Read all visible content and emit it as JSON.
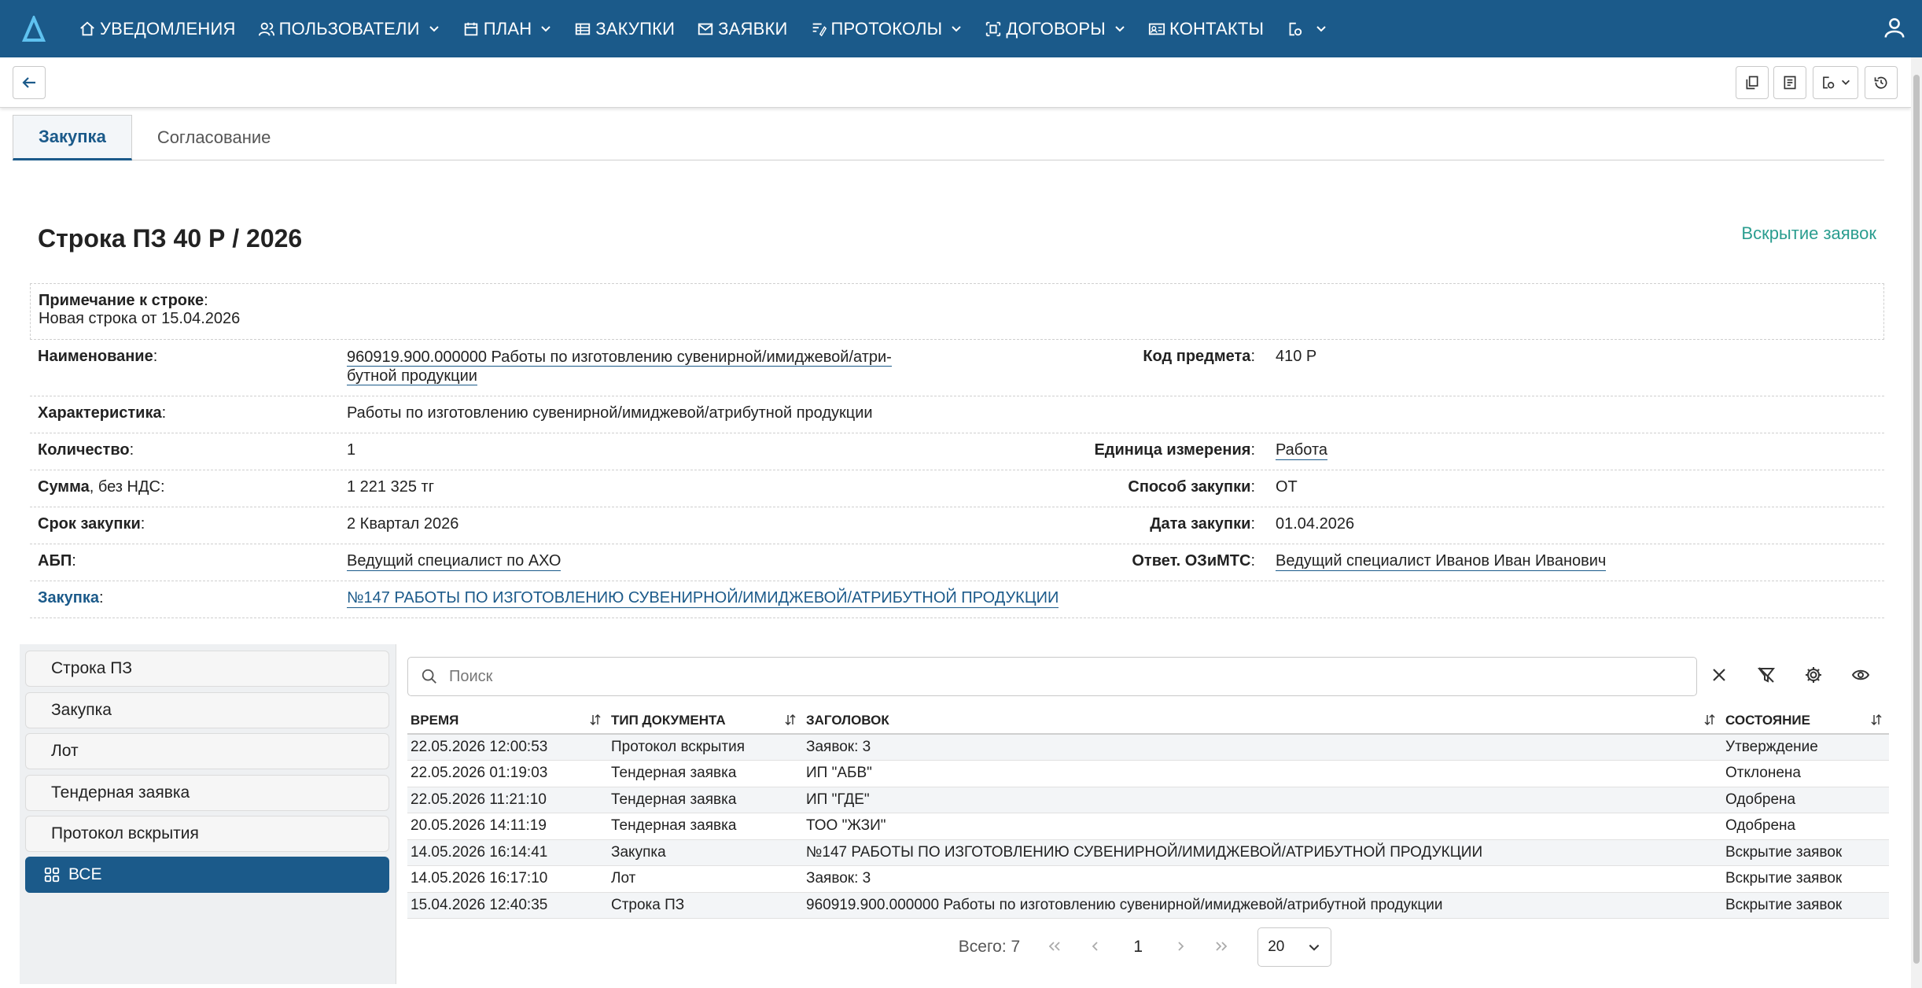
{
  "nav": {
    "items": [
      {
        "label": "УВЕДОМЛЕНИЯ",
        "icon": "home-icon",
        "chevron": false
      },
      {
        "label": "ПОЛЬЗОВАТЕЛИ",
        "icon": "users-icon",
        "chevron": true
      },
      {
        "label": "ПЛАН",
        "icon": "calendar-icon",
        "chevron": true
      },
      {
        "label": "ЗАКУПКИ",
        "icon": "table-icon",
        "chevron": false
      },
      {
        "label": "ЗАЯВКИ",
        "icon": "mail-icon",
        "chevron": false
      },
      {
        "label": "ПРОТОКОЛЫ",
        "icon": "edit-doc-icon",
        "chevron": true
      },
      {
        "label": "ДОГОВОРЫ",
        "icon": "contract-icon",
        "chevron": true
      },
      {
        "label": "КОНТАКТЫ",
        "icon": "contact-card-icon",
        "chevron": false
      }
    ]
  },
  "tabs": [
    {
      "label": "Закупка",
      "active": true
    },
    {
      "label": "Согласование",
      "active": false
    }
  ],
  "page": {
    "title": "Строка ПЗ 40 Р / 2026",
    "status_link": "Вскрытие заявок"
  },
  "details": {
    "note_label": "Примечание к строке",
    "note_value": "Новая строка от 15.04.2026",
    "name_label": "Наименование",
    "name_value_1": "960919.900.000000 Работы по изготовлению сувенирной/имиджевой/атри-",
    "name_value_2": "бутной продукции",
    "code_label": "Код предмета",
    "code_value": "410 Р",
    "char_label": "Характеристика",
    "char_value": "Работы по изготовлению сувенирной/имиджевой/атрибутной продукции",
    "qty_label": "Количество",
    "qty_value": "1",
    "unit_label": "Единица измерения",
    "unit_value": "Работа",
    "sum_label": "Сумма",
    "sum_suffix": ", без НДС",
    "sum_value": "1 221 325 тг",
    "method_label": "Способ закупки",
    "method_value": "ОТ",
    "term_label": "Срок закупки",
    "term_value": "2 Квартал 2026",
    "date_label": "Дата закупки",
    "date_value": "01.04.2026",
    "abp_label": "АБП",
    "abp_value": "Ведущий специалист по АХО",
    "resp_label": "Ответ. ОЗиМТС",
    "resp_value": "Ведущий специалист Иванов Иван Иванович",
    "purchase_label": "Закупка",
    "purchase_value": "№147 РАБОТЫ ПО ИЗГОТОВЛЕНИЮ СУВЕНИРНОЙ/ИМИДЖЕВОЙ/АТРИБУТНОЙ ПРОДУКЦИИ"
  },
  "sidebar": {
    "items": [
      "Строка ПЗ",
      "Закупка",
      "Лот",
      "Тендерная заявка",
      "Протокол вскрытия"
    ],
    "all_label": "ВСЕ"
  },
  "search": {
    "placeholder": "Поиск"
  },
  "table": {
    "headers": [
      "ВРЕМЯ",
      "ТИП ДОКУМЕНТА",
      "ЗАГОЛОВОК",
      "СОСТОЯНИЕ"
    ],
    "rows": [
      [
        "22.05.2026 12:00:53",
        "Протокол вскрытия",
        "Заявок: 3",
        "Утверждение"
      ],
      [
        "22.05.2026 01:19:03",
        "Тендерная заявка",
        "ИП \"АБВ\"",
        "Отклонена"
      ],
      [
        "22.05.2026 11:21:10",
        "Тендерная заявка",
        "ИП \"ГДЕ\"",
        "Одобрена"
      ],
      [
        "20.05.2026 14:11:19",
        "Тендерная заявка",
        "ТОО \"ЖЗИ\"",
        "Одобрена"
      ],
      [
        "14.05.2026 16:14:41",
        "Закупка",
        "№147 РАБОТЫ ПО ИЗГОТОВЛЕНИЮ СУВЕНИРНОЙ/ИМИДЖЕВОЙ/АТРИБУТНОЙ ПРОДУКЦИИ",
        "Вскрытие заявок"
      ],
      [
        "14.05.2026 16:17:10",
        "Лот",
        "Заявок: 3",
        "Вскрытие заявок"
      ],
      [
        "15.04.2026 12:40:35",
        "Строка ПЗ",
        "960919.900.000000 Работы по изготовлению сувенирной/имиджевой/атрибутной продукции",
        "Вскрытие заявок"
      ]
    ]
  },
  "pager": {
    "total": "Всего: 7",
    "current": "1",
    "page_size": "20"
  }
}
